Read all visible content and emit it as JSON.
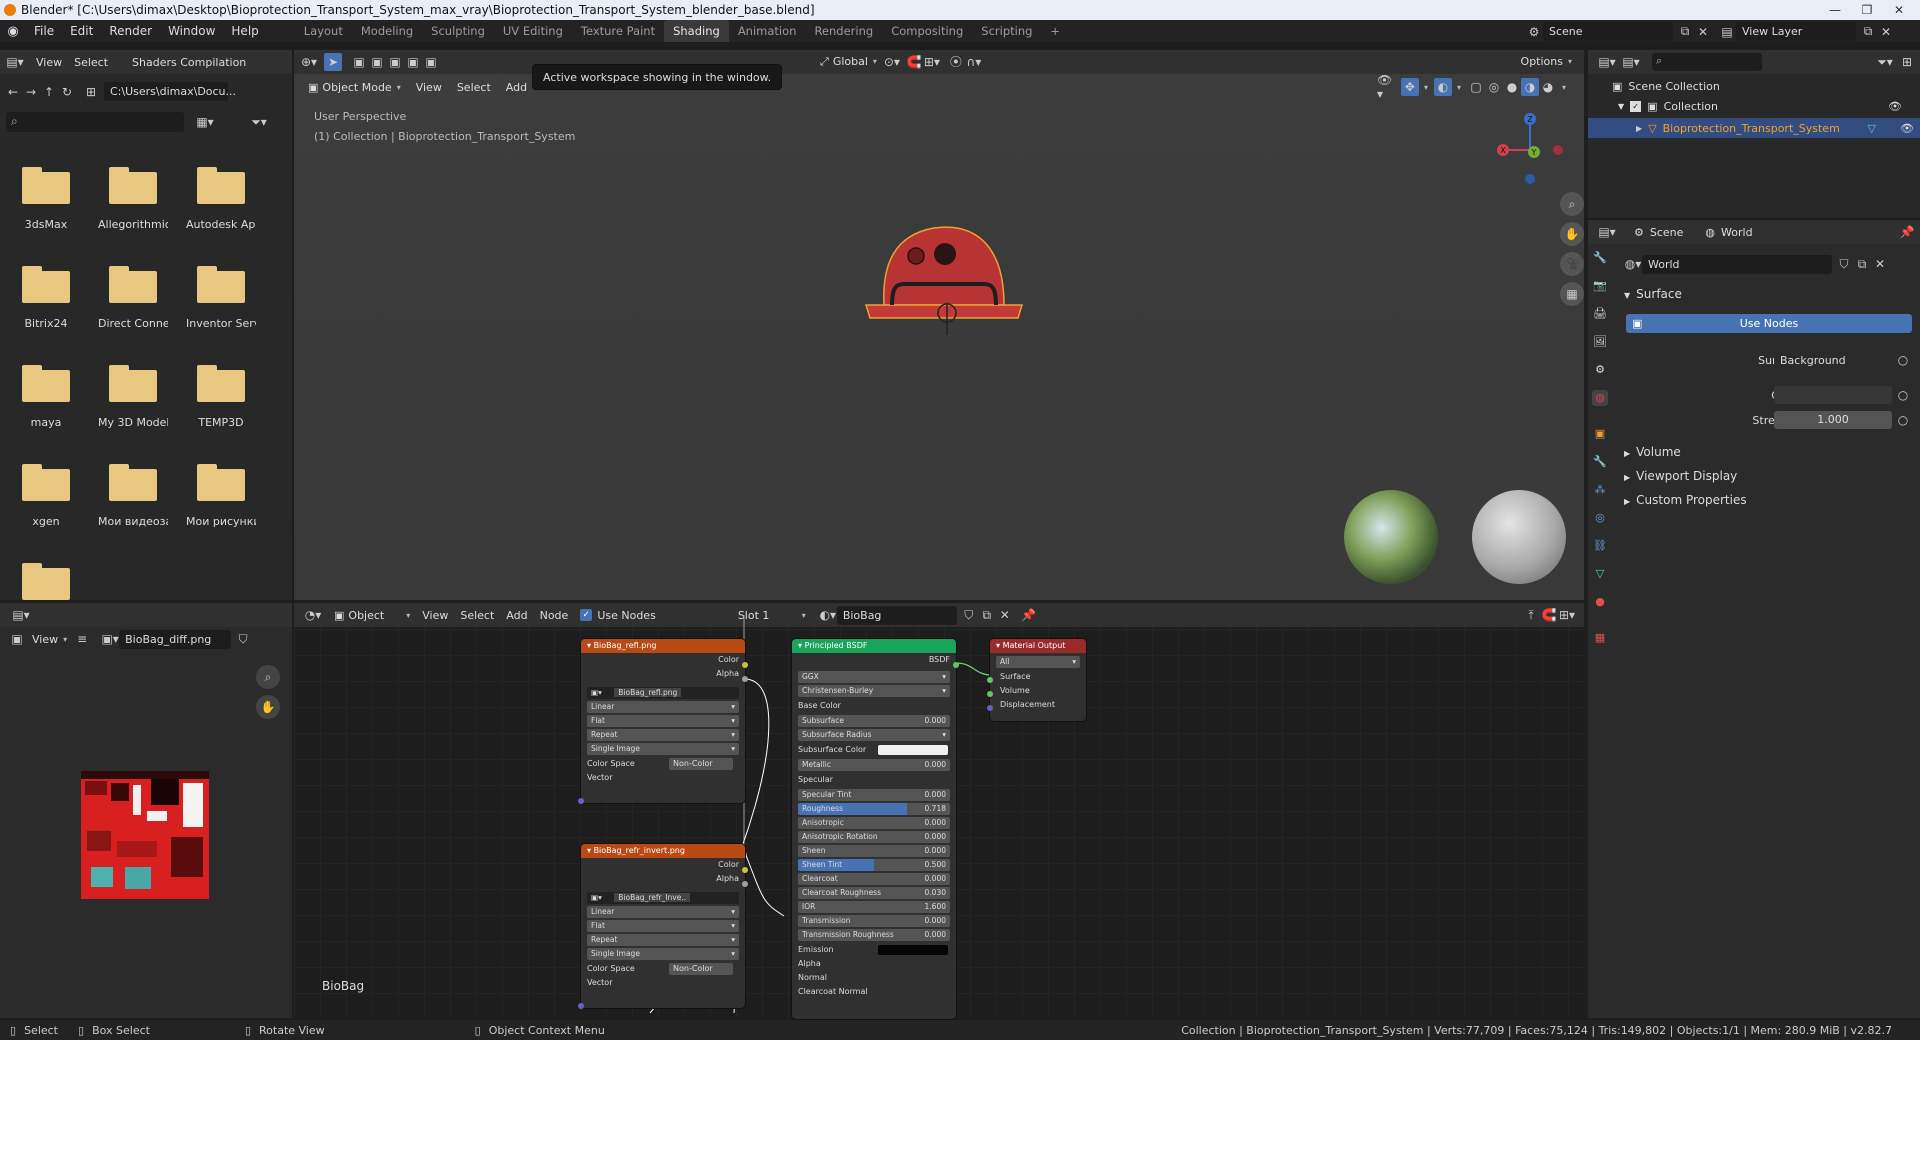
{
  "window": {
    "title": "Blender* [C:\\Users\\dimax\\Desktop\\Bioprotection_Transport_System_max_vray\\Bioprotection_Transport_System_blender_base.blend]"
  },
  "menu": [
    "File",
    "Edit",
    "Render",
    "Window",
    "Help"
  ],
  "workspaces": [
    "Layout",
    "Modeling",
    "Sculpting",
    "UV Editing",
    "Texture Paint",
    "Shading",
    "Animation",
    "Rendering",
    "Compositing",
    "Scripting"
  ],
  "active_workspace": "Shading",
  "topright": {
    "scene_label": "Scene",
    "view_layer_label": "View Layer"
  },
  "filebrowser": {
    "view": "View",
    "select": "Select",
    "bookmark": "Shaders Compilation",
    "path": "C:\\Users\\dimax\\Docu...",
    "folders": [
      "3dsMax",
      "Allegorithmic",
      "Autodesk App..",
      "Bitrix24",
      "Direct Connect",
      "Inventor Serv..",
      "maya",
      "My 3D Models",
      "TEMP3D",
      "xgen",
      "Мои видеоза..",
      "Мои рисунки"
    ]
  },
  "viewport": {
    "mode": "Object Mode",
    "view": "View",
    "select": "Select",
    "add": "Add",
    "orientation": "Global",
    "options": "Options",
    "tooltip": "Active workspace showing in the window.",
    "overlay_line1": "User Perspective",
    "overlay_line2": "(1) Collection | Bioprotection_Transport_System",
    "axes": {
      "x": "X",
      "y": "Y",
      "z": "Z"
    }
  },
  "image_editor": {
    "view": "View",
    "image_name": "BioBag_diff.png"
  },
  "node_editor": {
    "type": "Object",
    "view": "View",
    "select": "Select",
    "add": "Add",
    "node": "Node",
    "use_nodes": "Use Nodes",
    "slot": "Slot 1",
    "material": "BioBag",
    "corner_label": "BioBag",
    "node1": {
      "title": "BioBag_refl.png",
      "out1": "Color",
      "out2": "Alpha",
      "image": "BioBag_refl.png",
      "interp": "Linear",
      "proj": "Flat",
      "ext": "Repeat",
      "src": "Single Image",
      "cs_label": "Color Space",
      "cs_value": "Non-Color",
      "vector": "Vector"
    },
    "node2": {
      "title": "BioBag_refr_invert.png",
      "out1": "Color",
      "out2": "Alpha",
      "image": "BioBag_refr_Inve..",
      "interp": "Linear",
      "proj": "Flat",
      "ext": "Repeat",
      "src": "Single Image",
      "cs_label": "Color Space",
      "cs_value": "Non-Color",
      "vector": "Vector"
    },
    "bsdf": {
      "title": "Principled BSDF",
      "out": "BSDF",
      "dist": "GGX",
      "sss": "Christensen-Burley",
      "base_color": "Base Color",
      "subsurface": "Subsurface",
      "subsurface_v": "0.000",
      "subsurface_radius": "Subsurface Radius",
      "subsurface_color": "Subsurface Color",
      "metallic": "Metallic",
      "metallic_v": "0.000",
      "specular": "Specular",
      "specular_tint": "Specular Tint",
      "specular_tint_v": "0.000",
      "roughness": "Roughness",
      "roughness_v": "0.718",
      "anisotropic": "Anisotropic",
      "anisotropic_v": "0.000",
      "anisotropic_rot": "Anisotropic Rotation",
      "anisotropic_rot_v": "0.000",
      "sheen": "Sheen",
      "sheen_v": "0.000",
      "sheen_tint": "Sheen Tint",
      "sheen_tint_v": "0.500",
      "clearcoat": "Clearcoat",
      "clearcoat_v": "0.000",
      "clearcoat_rough": "Clearcoat Roughness",
      "clearcoat_rough_v": "0.030",
      "ior": "IOR",
      "ior_v": "1.600",
      "transmission": "Transmission",
      "transmission_v": "0.000",
      "transmission_rough": "Transmission Roughness",
      "transmission_rough_v": "0.000",
      "emission": "Emission",
      "alpha": "Alpha",
      "normal": "Normal",
      "clearcoat_normal": "Clearcoat Normal"
    },
    "output": {
      "title": "Material Output",
      "target": "All",
      "surface": "Surface",
      "volume": "Volume",
      "displacement": "Displacement"
    }
  },
  "outliner": {
    "scene_collection": "Scene Collection",
    "collection": "Collection",
    "object": "Bioprotection_Transport_System"
  },
  "properties": {
    "crumb_scene": "Scene",
    "crumb_world": "World",
    "world_name": "World",
    "surface_section": "Surface",
    "use_nodes": "Use Nodes",
    "surface_label": "Surface",
    "surface_value": "Background",
    "color_label": "Color",
    "strength_label": "Strength",
    "strength_value": "1.000",
    "sections": [
      "Volume",
      "Viewport Display",
      "Custom Properties"
    ]
  },
  "statusbar": {
    "select": "Select",
    "box_select": "Box Select",
    "rotate": "Rotate View",
    "context": "Object Context Menu",
    "info": "Collection | Bioprotection_Transport_System | Verts:77,709 | Faces:75,124 | Tris:149,802 | Objects:1/1 | Mem: 280.9 MiB | v2.82.7"
  },
  "colors": {
    "accent": "#4772b3",
    "active_object": "#f0a030",
    "image_node": "#b94a15",
    "shader_node": "#18a55a",
    "output_node": "#9b2a2a"
  }
}
